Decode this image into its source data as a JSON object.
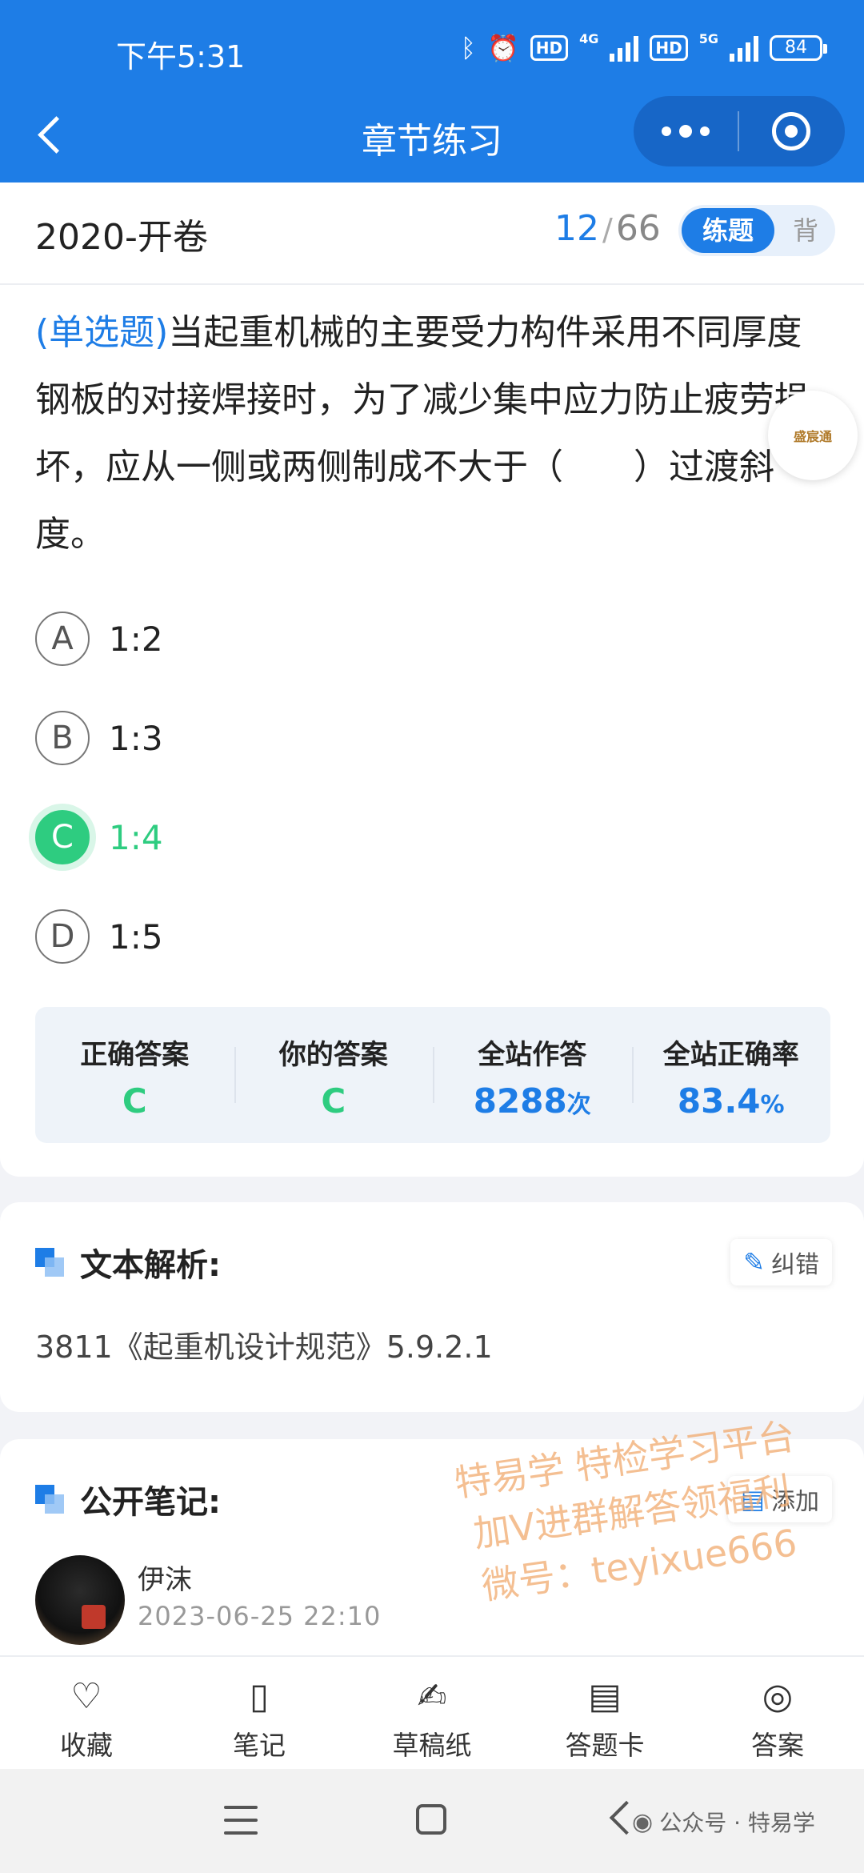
{
  "status": {
    "time": "下午5:31",
    "battery": "84",
    "net1": "4G",
    "net2": "5G",
    "hd": "HD"
  },
  "nav": {
    "title": "章节练习"
  },
  "header": {
    "paper": "2020-开卷",
    "current": "12",
    "separator": "/",
    "total": "66",
    "mode_active": "练题",
    "mode_inactive": "背"
  },
  "question": {
    "type_label": "(单选题)",
    "text": "当起重机械的主要受力构件采用不同厚度钢板的对接焊接时，为了减少集中应力防止疲劳损坏，应从一侧或两侧制成不大于（　　）过渡斜度。",
    "options": [
      {
        "letter": "A",
        "text": "1:2"
      },
      {
        "letter": "B",
        "text": "1:3"
      },
      {
        "letter": "C",
        "text": "1:4"
      },
      {
        "letter": "D",
        "text": "1:5"
      }
    ]
  },
  "stats": [
    {
      "label": "正确答案",
      "value": "C",
      "unit": ""
    },
    {
      "label": "你的答案",
      "value": "C",
      "unit": ""
    },
    {
      "label": "全站作答",
      "value": "8288",
      "unit": "次"
    },
    {
      "label": "全站正确率",
      "value": "83.4",
      "unit": "%"
    }
  ],
  "badge": "盛宸通",
  "analysis": {
    "title": "文本解析:",
    "button": "纠错",
    "body": "3811《起重机设计规范》5.9.2.1"
  },
  "notes": {
    "title": "公开笔记:",
    "button": "添加",
    "user": "伊沫",
    "time": "2023-06-25 22:10"
  },
  "watermark": [
    "特易学 特检学习平台",
    "加V进群解答领福利",
    "微号：teyixue666"
  ],
  "toolbar": [
    {
      "label": "收藏",
      "icon": "heart-icon"
    },
    {
      "label": "笔记",
      "icon": "notebook-icon"
    },
    {
      "label": "草稿纸",
      "icon": "draft-icon"
    },
    {
      "label": "答题卡",
      "icon": "clipboard-icon"
    },
    {
      "label": "答案",
      "icon": "eye-off-icon"
    }
  ],
  "sysnav": {
    "wechat": "公众号 · 特易学"
  },
  "colors": {
    "primary": "#1e7de6",
    "correct": "#2ecc80"
  }
}
